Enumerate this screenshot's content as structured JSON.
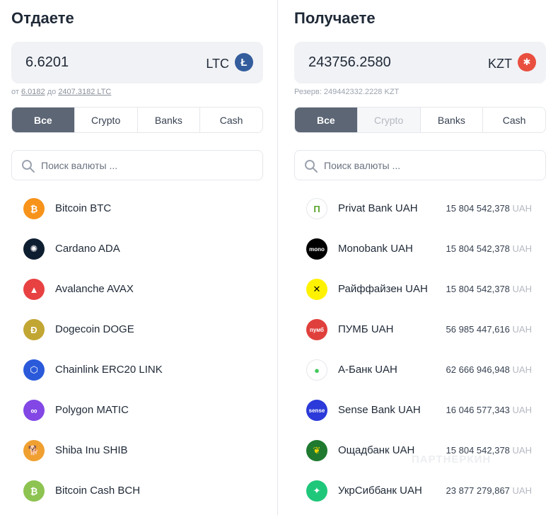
{
  "give": {
    "title": "Отдаете",
    "amount": "6.6201",
    "currency": "LTC",
    "hint_from": "от",
    "hint_min": "6.0182",
    "hint_to": "до",
    "hint_max": "2407.3182 LTC",
    "tabs": [
      {
        "label": "Все",
        "state": "active"
      },
      {
        "label": "Crypto",
        "state": "normal"
      },
      {
        "label": "Banks",
        "state": "normal"
      },
      {
        "label": "Cash",
        "state": "normal"
      }
    ],
    "search_placeholder": "Поиск валюты ...",
    "items": [
      {
        "name": "Bitcoin BTC",
        "icon": "bitcoin-icon",
        "color": "#f7931a",
        "glyph": "₿"
      },
      {
        "name": "Cardano ADA",
        "icon": "cardano-icon",
        "color": "#0d1e30",
        "glyph": "✺"
      },
      {
        "name": "Avalanche AVAX",
        "icon": "avalanche-icon",
        "color": "#e84142",
        "glyph": "▲"
      },
      {
        "name": "Dogecoin DOGE",
        "icon": "dogecoin-icon",
        "color": "#c2a633",
        "glyph": "Ð"
      },
      {
        "name": "Chainlink ERC20 LINK",
        "icon": "chainlink-icon",
        "color": "#2a5ada",
        "glyph": "⬡"
      },
      {
        "name": "Polygon MATIC",
        "icon": "polygon-icon",
        "color": "#8247e5",
        "glyph": "∞"
      },
      {
        "name": "Shiba Inu SHIB",
        "icon": "shiba-inu-icon",
        "color": "#f0a030",
        "glyph": "🐕"
      },
      {
        "name": "Bitcoin Cash BCH",
        "icon": "bitcoin-cash-icon",
        "color": "#8dc351",
        "glyph": "₿"
      }
    ]
  },
  "receive": {
    "title": "Получаете",
    "amount": "243756.2580",
    "currency": "KZT",
    "reserve_label": "Резерв: 249442332.2228 KZT",
    "tabs": [
      {
        "label": "Все",
        "state": "active"
      },
      {
        "label": "Crypto",
        "state": "disabled"
      },
      {
        "label": "Banks",
        "state": "normal"
      },
      {
        "label": "Cash",
        "state": "normal"
      }
    ],
    "search_placeholder": "Поиск валюты ...",
    "items": [
      {
        "name": "Privat Bank UAH",
        "reserve": "15 804 542,378",
        "unit": "UAH",
        "icon": "privatbank-icon",
        "color": "#ffffff",
        "glyph": "П",
        "fg": "#5aa52e"
      },
      {
        "name": "Monobank UAH",
        "reserve": "15 804 542,378",
        "unit": "UAH",
        "icon": "monobank-icon",
        "color": "#000000",
        "glyph": "mono",
        "fg": "#ffffff"
      },
      {
        "name": "Райффайзен UAH",
        "reserve": "15 804 542,378",
        "unit": "UAH",
        "icon": "raiffeisen-icon",
        "color": "#fff200",
        "glyph": "✕",
        "fg": "#000000"
      },
      {
        "name": "ПУМБ UAH",
        "reserve": "56 985 447,616",
        "unit": "UAH",
        "icon": "pumb-icon",
        "color": "#e0403c",
        "glyph": "пумб",
        "fg": "#ffffff"
      },
      {
        "name": "А-Банк UAH",
        "reserve": "62 666 946,948",
        "unit": "UAH",
        "icon": "abank-icon",
        "color": "#ffffff",
        "glyph": "●",
        "fg": "#43c95c"
      },
      {
        "name": "Sense Bank UAH",
        "reserve": "16 046 577,343",
        "unit": "UAH",
        "icon": "sense-bank-icon",
        "color": "#2b3ad8",
        "glyph": "sense",
        "fg": "#ffffff"
      },
      {
        "name": "Ощадбанк UAH",
        "reserve": "15 804 542,378",
        "unit": "UAH",
        "icon": "oschadbank-icon",
        "color": "#1f7a2f",
        "glyph": "❦",
        "fg": "#f2d300"
      },
      {
        "name": "УкрСиббанк UAH",
        "reserve": "23 877 279,867",
        "unit": "UAH",
        "icon": "ukrsibbank-icon",
        "color": "#1fc77a",
        "glyph": "✦",
        "fg": "#ffffff"
      }
    ]
  },
  "watermark": "ПАРТНЕРКИН"
}
